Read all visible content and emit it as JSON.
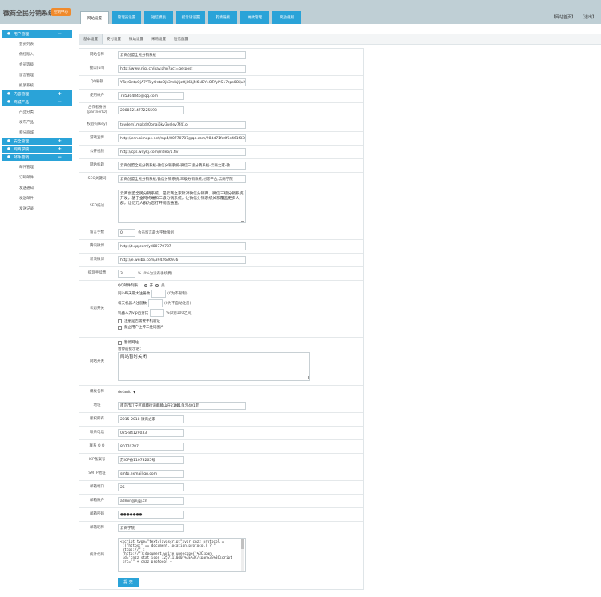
{
  "header": {
    "title": "微商全民分销系统",
    "badge": "控制中心",
    "tabs": [
      "网站设置",
      "管理员设置",
      "短信模板",
      "提示语设置",
      "友情链接",
      "纳款管理",
      "奖励规则"
    ],
    "links": [
      "【网站首页】",
      "【退出】"
    ]
  },
  "sidebar": {
    "groups": [
      {
        "title": "用户管理",
        "toggle": "−",
        "items": [
          "会员列表",
          "佣红账入",
          "会员等级",
          "留言管理",
          "抓紧系统"
        ]
      },
      {
        "title": "内容管理",
        "toggle": "+",
        "items": []
      },
      {
        "title": "商城产品",
        "toggle": "−",
        "items": [
          "产品分类",
          "发布产品",
          "积分商城"
        ]
      },
      {
        "title": "安全管理",
        "toggle": "+",
        "items": []
      },
      {
        "title": "网商学院",
        "toggle": "+",
        "items": []
      },
      {
        "title": "邮件营销",
        "toggle": "−",
        "items": [
          "邮件管理",
          "订邮邮件",
          "发送通知",
          "发送邮件",
          "发送记录"
        ]
      }
    ]
  },
  "subtabs": [
    "基本设置",
    "支付设置",
    "微站设置",
    "采购设置",
    "短信配置"
  ],
  "form": {
    "site_name": {
      "label": "网站名称",
      "value": "云商创盟全民分销系统"
    },
    "api_url": {
      "label": "接口(url)",
      "value": "http://www.njgj.cn/pay.php?act=getpost"
    },
    "qq_pw": {
      "label": "QQ秘钥",
      "value": "YToyOntpOjA7YToyOntzOjk3mIkjtjzOjk6LjM6NDY4OTAyNS17cps0OiJuY"
    },
    "alipay": {
      "label": "使用帐户",
      "value": "735304846@qq.com"
    },
    "partner": {
      "label": "合作者身份\n(partnerID)",
      "value": "2088121477225593"
    },
    "key": {
      "label": "校验码(key)",
      "value": "tovdem1mpkdz0bnaj6kv3velev7f41o"
    },
    "mp4": {
      "label": "游戏宣传",
      "value": "http://cdn.oimope.net/mp4/80770787@qq.com/98dd71fcdf6e461f836c"
    },
    "video": {
      "label": "公开视频",
      "value": "http://cps.wdykj.com/Video/1.flv"
    },
    "seo_title": {
      "label": "网站标题",
      "value": "云商创盟全民分销系统-微信分销系统-微信三级分销系统-云商之家-微"
    },
    "seo_kw": {
      "label": "SEO关键词",
      "value": "云商创盟全民分销系统,微信分销系统,三级分销系统,创客平台,云商学院"
    },
    "seo_desc": {
      "label": "SEO描述",
      "value": "云商创盟全民分销系统，是云商之家针对微信分销商、微信三级分销系统开发，基于全网终端和三级分销系统，让微信分销系统关系覆盖更多人群，让亿万人群为您打开销售通道。"
    },
    "reply_chars": {
      "label": "留言字数",
      "value": "0",
      "note": "会员留言最大字数限制"
    },
    "tencent": {
      "label": "腾讯微博",
      "value": "http://t.qq.com/yd80770787"
    },
    "sina": {
      "label": "新浪微博",
      "value": "http://e.weibo.com/3942636936"
    },
    "fee": {
      "label": "提现手续费",
      "value": "3",
      "note": "% (0%为没有手续费)"
    },
    "status": {
      "label": "状态开关",
      "qq_login": "QQ邮件列表：",
      "on": "开",
      "off": "关",
      "daily_reg": "同ip每天最大注册数",
      "daily_reg_note": "(0为不限制)",
      "robot_reg": "每天机器人注册数",
      "robot_reg_note": "(0为不自动注册)",
      "vip_rate": "机器人为vip百分比",
      "vip_rate_note": "%(0到100之间)",
      "chk1": "注册是否需要手机验证",
      "chk2": "禁止用户上传二维码图片"
    },
    "site_switch": {
      "label": "网站开关",
      "pause": "暂停网站",
      "tip_label": "暂停前提示语：",
      "tip": "网站暂时关闭"
    },
    "template": {
      "label": "模板名称",
      "value": "default"
    },
    "address": {
      "label": "地址",
      "value": "南京市江宁区麒麟街道麒麟山庄21幢1单元401室"
    },
    "copyright": {
      "label": "版权所有",
      "value": "2015-2018 微商之家"
    },
    "phone": {
      "label": "联系电话",
      "value": "025-84129033"
    },
    "qq": {
      "label": "联系 Q Q",
      "value": "80770787"
    },
    "icp": {
      "label": "ICP备案号",
      "value": "苏ICP备11073265号"
    },
    "smtp": {
      "label": "SMTP地址",
      "value": "smtp.exmail.qq.com"
    },
    "port": {
      "label": "邮箱端口",
      "value": "25"
    },
    "mail_user": {
      "label": "邮箱账户",
      "value": "admin@njgj.cn"
    },
    "mail_pw": {
      "label": "邮箱密码",
      "value": "●●●●●●●"
    },
    "mail_name": {
      "label": "邮箱昵称",
      "value": "云商学院"
    },
    "stats": {
      "label": "统计代码",
      "value": "<script type=\"text/javascript\">var cnzz_protocol =\n ((\"https:\" == document.location.protocol) ? \"\n https://\" :\n \"http://\");document.write(unescape(\"%3Cspan\n id='cnzz_stat_icon_1257111040'%3E%3C/span%3E%3Cscript\n src='\" + cnzz_protocol +"
    },
    "submit": "提 交"
  }
}
